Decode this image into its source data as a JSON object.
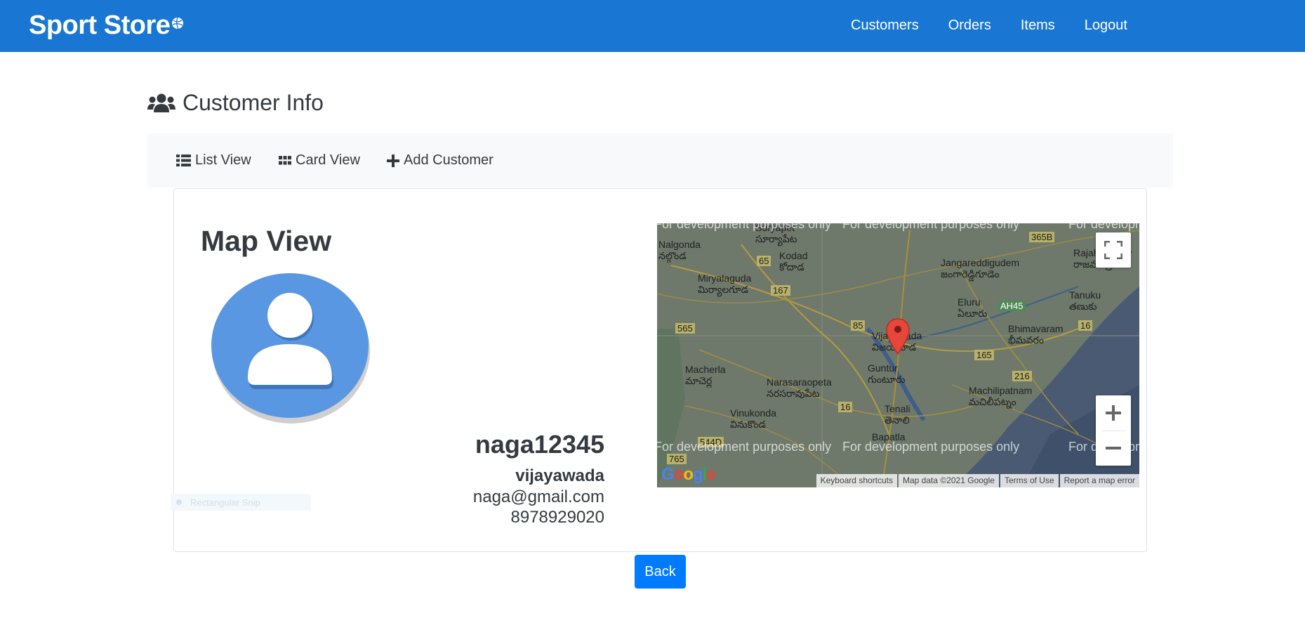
{
  "navbar": {
    "brand": "Sport Store",
    "links": [
      "Customers",
      "Orders",
      "Items",
      "Logout"
    ],
    "color": "#1976d2"
  },
  "page": {
    "title": "Customer Info",
    "title_icon": "users-icon"
  },
  "subnav": {
    "items": [
      {
        "label": "List View",
        "icon": "list-icon"
      },
      {
        "label": "Card View",
        "icon": "grid-icon"
      },
      {
        "label": "Add Customer",
        "icon": "plus-icon"
      }
    ]
  },
  "card": {
    "heading": "Map View",
    "avatar_icon": "user-avatar-icon",
    "snip_overlay": "Rectangular Snip",
    "customer": {
      "username": "naga12345",
      "city": "vijayawada",
      "email": "naga@gmail.com",
      "phone": "8978929020"
    }
  },
  "map": {
    "labels": [
      "Suryapet",
      "సూర్యాపేట",
      "Nalgonda",
      "నల్గొండ",
      "Kodad",
      "కోదాడ",
      "Miryalaguda",
      "మిర్యాలగూడ",
      "Jangareddigudem",
      "జంగారెడ్డిగూడెం",
      "Rajahmundry",
      "రాజమండ్రి",
      "Eluru",
      "ఏలూరు",
      "Tanuku",
      "తణుకు",
      "Vijayawada",
      "విజయవాడ",
      "Bhimavaram",
      "భీమవరం",
      "Macherla",
      "మాచెర్ల",
      "Guntur",
      "గుంటూరు",
      "Narasaraopeta",
      "నరసరావుపేట",
      "Machilipatnam",
      "మచిలీపట్నం",
      "Vinukonda",
      "వినుకొండ",
      "Tenali",
      "తెనాలి",
      "Bapatla"
    ],
    "road_shields": [
      "65",
      "365B",
      "167",
      "565",
      "85",
      "AH45",
      "16",
      "165",
      "216",
      "16",
      "544D",
      "765"
    ],
    "watermark": "For development purposes only",
    "attribution": [
      "Keyboard shortcuts",
      "Map data ©2021 Google",
      "Terms of Use",
      "Report a map error"
    ],
    "logo": "Google",
    "controls": {
      "zoom_in": "+",
      "zoom_out": "−"
    }
  },
  "actions": {
    "back_label": "Back"
  }
}
